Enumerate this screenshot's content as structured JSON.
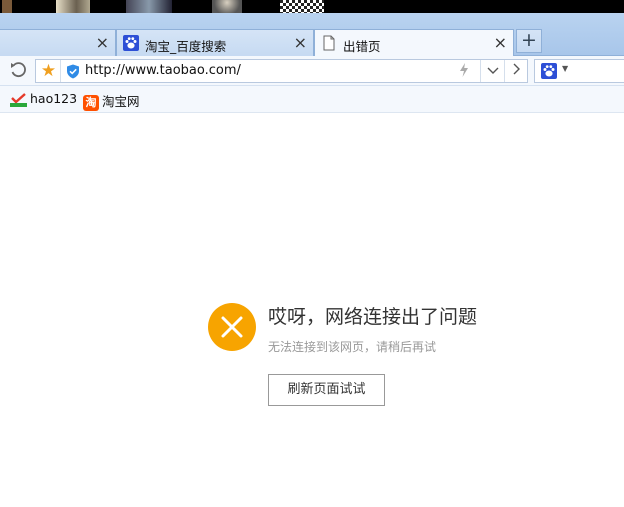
{
  "tabs": [
    {
      "label": "",
      "icon": "blank-tab-icon"
    },
    {
      "label": "淘宝_百度搜索",
      "icon": "baidu-paw-icon"
    },
    {
      "label": "出错页",
      "icon": "page-icon",
      "active": true
    }
  ],
  "tab_close_glyph": "×",
  "new_tab_glyph": "+",
  "address": {
    "url": "http://www.taobao.com/"
  },
  "bookmarks": [
    {
      "label": "hao123",
      "icon": "hao123-icon"
    },
    {
      "label": "淘宝网",
      "icon": "taobao-icon",
      "icon_text": "淘"
    }
  ],
  "error": {
    "title": "哎呀，网络连接出了问题",
    "subtitle": "无法连接到该网页，请稍后再试",
    "retry_label": "刷新页面试试",
    "icon_color": "#f7a400"
  }
}
